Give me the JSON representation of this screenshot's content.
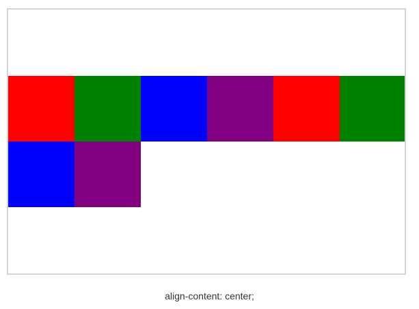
{
  "demo": {
    "items": [
      {
        "color": "#ff0000"
      },
      {
        "color": "#008000"
      },
      {
        "color": "#0000ff"
      },
      {
        "color": "#800080"
      },
      {
        "color": "#ff0000"
      },
      {
        "color": "#008000"
      },
      {
        "color": "#0000ff"
      },
      {
        "color": "#800080"
      }
    ]
  },
  "caption": "align-content: center;"
}
